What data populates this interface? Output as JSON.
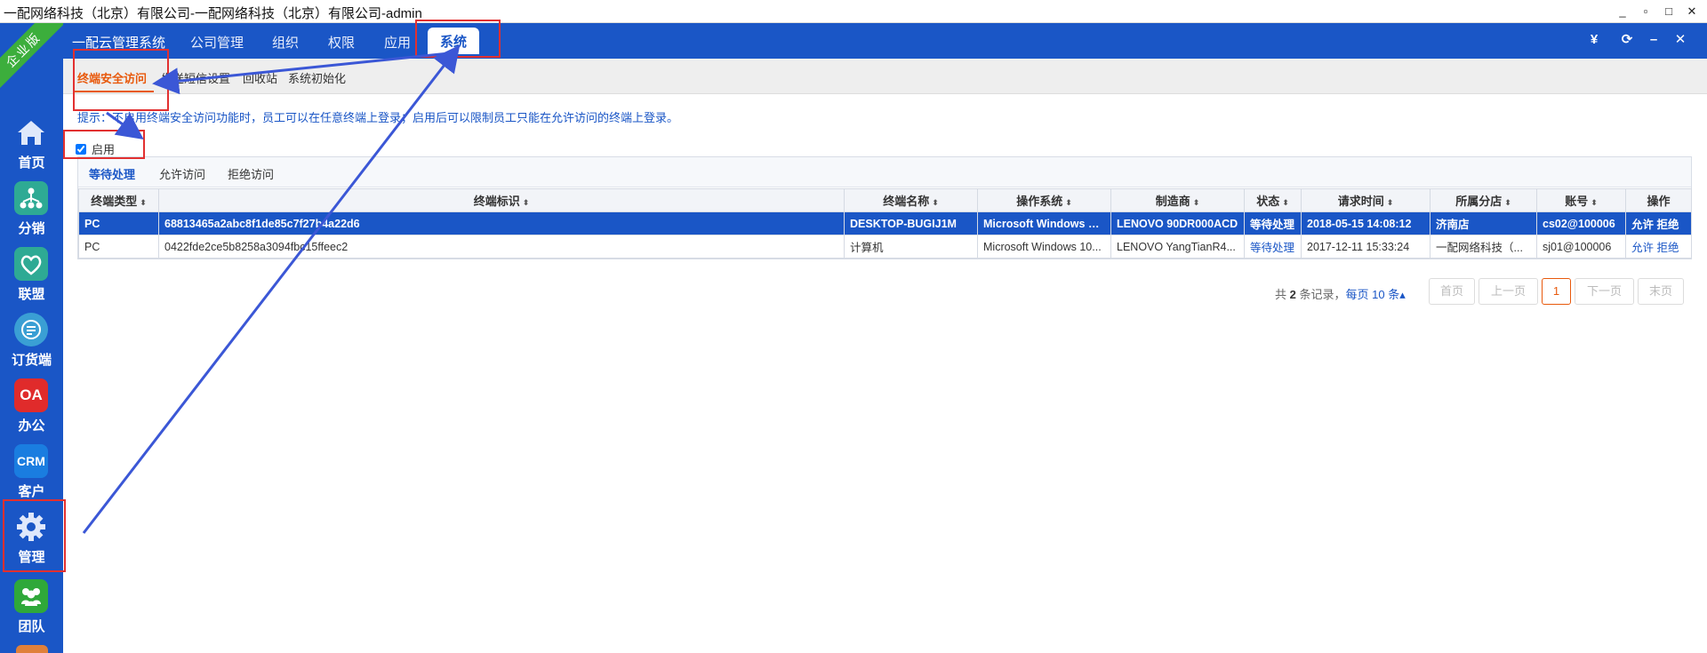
{
  "window": {
    "title": "一配网络科技（北京）有限公司-一配网络科技（北京）有限公司-admin",
    "controls": [
      "_",
      "▫",
      "□",
      "✕"
    ]
  },
  "sidebar": {
    "badge": "企业版",
    "items": [
      {
        "label": "首页",
        "icon": "home-icon",
        "color": "#1a56c6"
      },
      {
        "label": "分销",
        "icon": "distribution-icon",
        "color": "#2eaa94"
      },
      {
        "label": "联盟",
        "icon": "alliance-icon",
        "color": "#2eaa94"
      },
      {
        "label": "订货端",
        "icon": "order-icon",
        "color": "#3a9fd4"
      },
      {
        "label": "办公",
        "icon_text": "OA",
        "color": "#e02b2b"
      },
      {
        "label": "客户",
        "icon_text": "CRM",
        "color": "#1a7de0"
      },
      {
        "label": "管理",
        "icon": "gear-icon",
        "color": "#1a56c6"
      },
      {
        "label": "团队",
        "icon": "team-icon",
        "color": "#2fa83a"
      }
    ]
  },
  "topnav": {
    "brand": "一配云管理系统",
    "tabs": [
      "公司管理",
      "组织",
      "权限",
      "应用",
      "系统"
    ],
    "active_tab": "系统",
    "right_icons": [
      "¥",
      "⟳",
      "–",
      "✕"
    ]
  },
  "subnav": {
    "items": [
      "终端安全访问",
      "发送短信设置",
      "回收站",
      "系统初始化"
    ],
    "active": "终端安全访问"
  },
  "content": {
    "hint": "提示：不启用终端安全访问功能时，员工可以在任意终端上登录；启用后可以限制员工只能在允许访问的终端上登录。",
    "enable_label": "启用",
    "enabled": true,
    "inner_tabs": [
      "等待处理",
      "允许访问",
      "拒绝访问"
    ],
    "active_inner_tab": "等待处理",
    "columns": [
      "终端类型",
      "终端标识",
      "终端名称",
      "操作系统",
      "制造商",
      "状态",
      "请求时间",
      "所属分店",
      "账号",
      "操作"
    ],
    "rows": [
      {
        "type": "PC",
        "id": "68813465a2abc8f1de85c7f27b4a22d6",
        "name": "DESKTOP-BUGIJ1M",
        "os": "Microsoft Windows 10...",
        "maker": "LENOVO 90DR000ACD",
        "status": "等待处理",
        "time": "2018-05-15 14:08:12",
        "store": "济南店",
        "account": "cs02@100006",
        "allow": "允许",
        "deny": "拒绝",
        "selected": true
      },
      {
        "type": "PC",
        "id": "0422fde2ce5b8258a3094fbc15ffeec2",
        "name": "计算机",
        "os": "Microsoft Windows 10...",
        "maker": "LENOVO YangTianR4...",
        "status": "等待处理",
        "time": "2017-12-11 15:33:24",
        "store": "一配网络科技（...",
        "account": "sj01@100006",
        "allow": "允许",
        "deny": "拒绝",
        "selected": false
      }
    ],
    "pager": {
      "total_prefix": "共",
      "total": "2",
      "total_suffix": "条记录，",
      "per_page": "每页 10 条",
      "per_page_arrow": "▴",
      "first": "首页",
      "prev": "上一页",
      "page": "1",
      "next": "下一页",
      "last": "末页"
    }
  },
  "colors": {
    "brand_blue": "#1a56c6",
    "accent_orange": "#e8590c",
    "annotation_red": "#e23030",
    "badge_green": "#3cae3c"
  }
}
